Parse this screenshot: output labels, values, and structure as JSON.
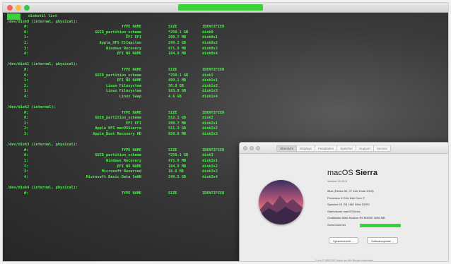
{
  "terminal": {
    "prompt": "diskutil list",
    "lines": [
      {
        "kind": "header",
        "text": "/dev/disk0 (internal, physical):"
      },
      {
        "kind": "cols",
        "num": "#:",
        "type": "TYPE NAME",
        "size": "SIZE",
        "id": "IDENTIFIER"
      },
      {
        "kind": "row",
        "num": "0:",
        "type": "GUID_partition_scheme",
        "size": "*250.1 GB",
        "id": "disk0"
      },
      {
        "kind": "row",
        "num": "1:",
        "type": "EFI EFI",
        "size": "209.7 MB",
        "id": "disk0s1"
      },
      {
        "kind": "row",
        "num": "2:",
        "type": "Apple_HFS ElCapitan",
        "size": "249.2 GB",
        "id": "disk0s2"
      },
      {
        "kind": "row",
        "num": "3:",
        "type": "Windows Recovery",
        "size": "471.9 MB",
        "id": "disk0s3"
      },
      {
        "kind": "row",
        "num": "4:",
        "type": "EFI NO NAME",
        "size": "104.9 MB",
        "id": "disk0s4"
      },
      {
        "kind": "blank"
      },
      {
        "kind": "header",
        "text": "/dev/disk1 (internal, physical):"
      },
      {
        "kind": "cols",
        "num": "#:",
        "type": "TYPE NAME",
        "size": "SIZE",
        "id": "IDENTIFIER"
      },
      {
        "kind": "row",
        "num": "0:",
        "type": "GUID_partition_scheme",
        "size": "*250.1 GB",
        "id": "disk1"
      },
      {
        "kind": "row",
        "num": "1:",
        "type": "EFI NO NAME",
        "size": "499.1 MB",
        "id": "disk1s1"
      },
      {
        "kind": "row",
        "num": "2:",
        "type": "Linux Filesystem",
        "size": "30.0 GB",
        "id": "disk1s2"
      },
      {
        "kind": "row",
        "num": "3:",
        "type": "Linux Filesystem",
        "size": "163.9 GB",
        "id": "disk1s3"
      },
      {
        "kind": "row",
        "num": "4:",
        "type": "Linux Swap",
        "size": "4.6 GB",
        "id": "disk1s4"
      },
      {
        "kind": "blank"
      },
      {
        "kind": "header",
        "text": "/dev/disk2 (internal):"
      },
      {
        "kind": "cols",
        "num": "#:",
        "type": "TYPE NAME",
        "size": "SIZE",
        "id": "IDENTIFIER"
      },
      {
        "kind": "row",
        "num": "0:",
        "type": "GUID_partition_scheme",
        "size": "512.1 GB",
        "id": "disk2"
      },
      {
        "kind": "row",
        "num": "1:",
        "type": "EFI EFI",
        "size": "209.7 MB",
        "id": "disk2s1"
      },
      {
        "kind": "row",
        "num": "2:",
        "type": "Apple_HFS macOSSierra",
        "size": "511.3 GB",
        "id": "disk2s2"
      },
      {
        "kind": "row",
        "num": "3:",
        "type": "Apple_Boot Recovery HD",
        "size": "650.0 MB",
        "id": "disk2s3"
      },
      {
        "kind": "blank"
      },
      {
        "kind": "header",
        "text": "/dev/disk3 (internal, physical):"
      },
      {
        "kind": "cols",
        "num": "#:",
        "type": "TYPE NAME",
        "size": "SIZE",
        "id": "IDENTIFIER"
      },
      {
        "kind": "row",
        "num": "0:",
        "type": "GUID_partition_scheme",
        "size": "*250.1 GB",
        "id": "disk3"
      },
      {
        "kind": "row",
        "num": "1:",
        "type": "Windows Recovery",
        "size": "471.9 MB",
        "id": "disk3s1"
      },
      {
        "kind": "row",
        "num": "2:",
        "type": "EFI NO NAME",
        "size": "104.9 MB",
        "id": "disk3s2"
      },
      {
        "kind": "row",
        "num": "3:",
        "type": "Microsoft Reserved",
        "size": "16.8 MB",
        "id": "disk3s3"
      },
      {
        "kind": "row",
        "num": "4:",
        "type": "Microsoft Basic Data SeWN",
        "size": "249.5 GB",
        "id": "disk3s4"
      },
      {
        "kind": "blank"
      },
      {
        "kind": "header",
        "text": "/dev/disk4 (internal, physical):"
      },
      {
        "kind": "cols",
        "num": "#:",
        "type": "TYPE NAME",
        "size": "SIZE",
        "id": "IDENTIFIER"
      }
    ]
  },
  "about": {
    "tabs": [
      "Übersicht",
      "Displays",
      "Festplatten",
      "Speicher",
      "Support",
      "Service"
    ],
    "active_tab": 0,
    "os_name": "macOS",
    "os_codename": "Sierra",
    "version": "Version 10.12.6",
    "specs": [
      "iMac (Retina 5K, 27 Zoll, Ende 2015)",
      "Prozessor   4 GHz Intel Core i7",
      "Speicher   24 GB 1867 MHz DDR3",
      "Startvolume   macOSSierra",
      "Grafikkarte   AMD Radeon R9 M395X 4096 MB",
      "Seriennummer"
    ],
    "buttons": [
      "Systembericht ...",
      "Softwareupdate ..."
    ],
    "footer": "™ und © 1983-2017 Apple Inc. Alle Rechte vorbehalten."
  }
}
